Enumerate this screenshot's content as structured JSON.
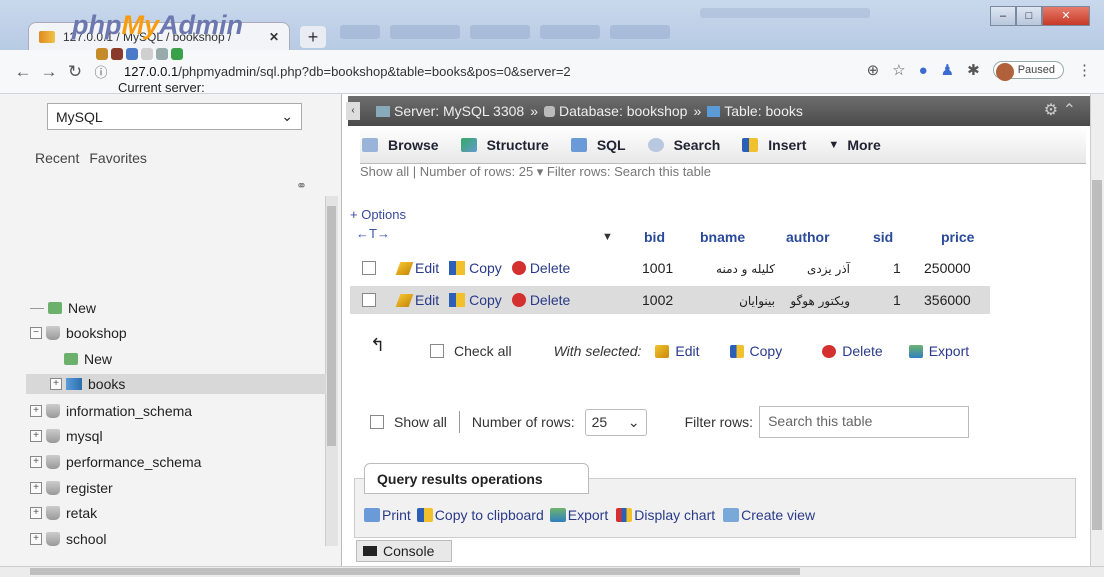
{
  "browser": {
    "tab_title": "127.0.0.1 / MySQL / bookshop /",
    "new_tab": "+",
    "window_min": "–",
    "window_max": "□",
    "window_close": "✕",
    "url_prefix": "127.0.0.1",
    "url_rest": "/phpmyadmin/sql.php?db=bookshop&table=books&pos=0&server=2",
    "paused_label": "Paused"
  },
  "sidebar": {
    "logo_php": "php",
    "logo_my": "My",
    "logo_admin": "Admin",
    "current_server_label": "Current server:",
    "server_value": "MySQL",
    "recent": "Recent",
    "favorites": "Favorites",
    "tree": [
      {
        "label": "New",
        "kind": "new"
      },
      {
        "label": "bookshop",
        "kind": "db"
      },
      {
        "label": "New",
        "kind": "new"
      },
      {
        "label": "books",
        "kind": "table"
      },
      {
        "label": "information_schema",
        "kind": "db"
      },
      {
        "label": "mysql",
        "kind": "db"
      },
      {
        "label": "performance_schema",
        "kind": "db"
      },
      {
        "label": "register",
        "kind": "db"
      },
      {
        "label": "retak",
        "kind": "db"
      },
      {
        "label": "school",
        "kind": "db"
      }
    ]
  },
  "breadcrumb": {
    "server": "Server: MySQL 3308",
    "database": "Database: bookshop",
    "table": "Table: books"
  },
  "menu": {
    "browse": "Browse",
    "structure": "Structure",
    "sql": "SQL",
    "search": "Search",
    "insert": "Insert",
    "more": "More"
  },
  "strip_text": "Show all  |  Number of rows:  25  ▾        Filter rows:  Search this table",
  "options_label": "+ Options",
  "table": {
    "sort_arrows": "←T→",
    "columns": [
      "bid",
      "bname",
      "author",
      "sid",
      "price"
    ],
    "rows": [
      {
        "edit": "Edit",
        "copy": "Copy",
        "delete": "Delete",
        "bid": "1001",
        "bname": "کلیله و دمنه",
        "author": "آذر یزدی",
        "sid": "1",
        "price": "250000"
      },
      {
        "edit": "Edit",
        "copy": "Copy",
        "delete": "Delete",
        "bid": "1002",
        "bname": "بینوایان",
        "author": "ویکتور هوگو",
        "sid": "1",
        "price": "356000"
      }
    ]
  },
  "bulk": {
    "check_all": "Check all",
    "with_selected": "With selected:",
    "edit": "Edit",
    "copy": "Copy",
    "delete": "Delete",
    "export": "Export"
  },
  "paging": {
    "show_all": "Show all",
    "number_of_rows": "Number of rows:",
    "rows_value": "25",
    "filter_rows": "Filter rows:",
    "search_placeholder": "Search this table"
  },
  "query_ops": {
    "title": "Query results operations",
    "print": "Print",
    "copy_clipboard": "Copy to clipboard",
    "export": "Export",
    "display_chart": "Display chart",
    "create_view": "Create view"
  },
  "console_label": "Console"
}
